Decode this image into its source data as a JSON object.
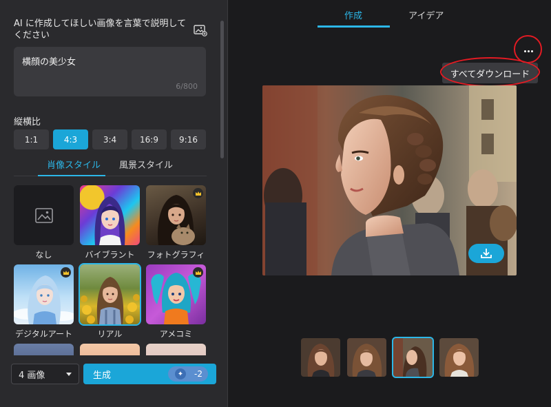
{
  "prompt": {
    "title": "AI に作成してほしい画像を言葉で説明してください",
    "value": "横顔の美少女",
    "counter": "6/800",
    "ref_icon": "image-add-icon"
  },
  "ratio": {
    "label": "縦横比",
    "options": [
      "1:1",
      "4:3",
      "3:4",
      "16:9",
      "9:16"
    ],
    "selected": "4:3"
  },
  "style_tabs": {
    "items": [
      "肖像スタイル",
      "風景スタイル"
    ],
    "active": "肖像スタイル"
  },
  "styles": [
    {
      "label": "なし",
      "premium": false
    },
    {
      "label": "バイブラント",
      "premium": false
    },
    {
      "label": "フォトグラフィ",
      "premium": true
    },
    {
      "label": "デジタルアート",
      "premium": true
    },
    {
      "label": "リアル",
      "premium": false,
      "selected": true
    },
    {
      "label": "アメコミ",
      "premium": true
    }
  ],
  "bottom": {
    "count_value": "4 画像",
    "generate_label": "生成",
    "cost": "-2"
  },
  "top_tabs": {
    "items": [
      "作成",
      "アイデア"
    ],
    "active": "作成"
  },
  "menu": {
    "more_icon": "more-horizontal-icon",
    "download_all": "すべてダウンロード"
  },
  "colors": {
    "accent": "#1ba6d8",
    "highlight_ring": "#e31b23",
    "panel": "#2a2a2d",
    "background": "#1b1b1d"
  },
  "results": {
    "count": 4,
    "selected_index": 2
  }
}
